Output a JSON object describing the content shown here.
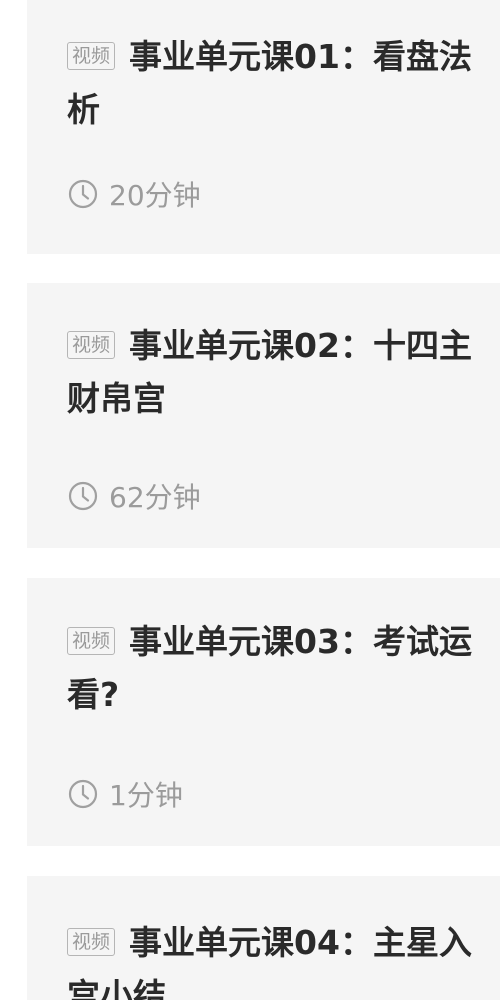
{
  "lessons": [
    {
      "badge": "视频",
      "title": "事业单元课01：看盘法",
      "title_line2": "析",
      "duration": "20分钟",
      "icon": "clock-icon"
    },
    {
      "badge": "视频",
      "title": "事业单元课02：十四主",
      "title_line2": "财帛宫",
      "duration": "62分钟",
      "icon": "clock-icon"
    },
    {
      "badge": "视频",
      "title": "事业单元课03：考试运",
      "title_line2": "看?",
      "duration": "1分钟",
      "icon": "clock-icon"
    },
    {
      "badge": "视频",
      "title": "事业单元课04：主星入",
      "title_line2": "宫小结",
      "duration": "",
      "icon": "clock-icon"
    }
  ]
}
